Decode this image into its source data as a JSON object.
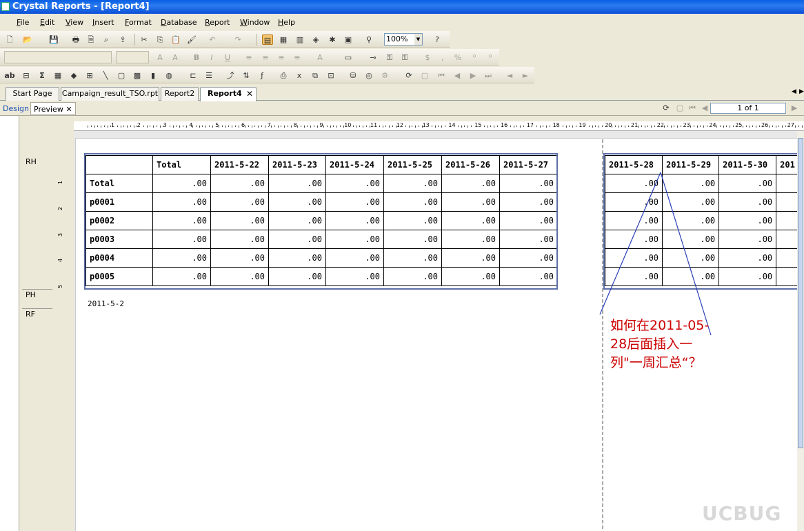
{
  "window": {
    "title": "Crystal Reports - [Report4]"
  },
  "menu": [
    "File",
    "Edit",
    "View",
    "Insert",
    "Format",
    "Database",
    "Report",
    "Window",
    "Help"
  ],
  "toolbar": {
    "zoom": "100%"
  },
  "doc_tabs": [
    {
      "label": "Start Page"
    },
    {
      "label": "Campaign_result_TSO.rpt"
    },
    {
      "label": "Report2"
    },
    {
      "label": "Report4",
      "active": true
    }
  ],
  "view_tabs": {
    "design": "Design",
    "preview": "Preview"
  },
  "navigator": {
    "page": "1 of 1"
  },
  "sections": {
    "rh": "RH",
    "ph": "PH",
    "rf": "RF"
  },
  "ruler_numbers": [
    "1",
    "2",
    "3",
    "4",
    "5",
    "6",
    "7",
    "8",
    "9",
    "10",
    "11",
    "12",
    "13",
    "14",
    "15",
    "16",
    "17",
    "18",
    "19",
    "20",
    "21",
    "22",
    "23",
    "24",
    "25",
    "26",
    "27"
  ],
  "vruler_numbers": [
    "1",
    "2",
    "3",
    "4",
    "5"
  ],
  "crosstab_left": {
    "header": [
      "",
      "Total",
      "2011-5-22",
      "2011-5-23",
      "2011-5-24",
      "2011-5-25",
      "2011-5-26",
      "2011-5-27"
    ],
    "rows": [
      {
        "label": "Total",
        "values": [
          ".00",
          ".00",
          ".00",
          ".00",
          ".00",
          ".00",
          ".00"
        ]
      },
      {
        "label": "p0001",
        "values": [
          ".00",
          ".00",
          ".00",
          ".00",
          ".00",
          ".00",
          ".00"
        ]
      },
      {
        "label": "p0002",
        "values": [
          ".00",
          ".00",
          ".00",
          ".00",
          ".00",
          ".00",
          ".00"
        ]
      },
      {
        "label": "p0003",
        "values": [
          ".00",
          ".00",
          ".00",
          ".00",
          ".00",
          ".00",
          ".00"
        ]
      },
      {
        "label": "p0004",
        "values": [
          ".00",
          ".00",
          ".00",
          ".00",
          ".00",
          ".00",
          ".00"
        ]
      },
      {
        "label": "p0005",
        "values": [
          ".00",
          ".00",
          ".00",
          ".00",
          ".00",
          ".00",
          ".00"
        ]
      }
    ]
  },
  "crosstab_right": {
    "header": [
      "2011-5-28",
      "2011-5-29",
      "2011-5-30",
      "201"
    ],
    "rows": [
      [
        ".00",
        ".00",
        ".00",
        ""
      ],
      [
        ".00",
        ".00",
        ".00",
        ""
      ],
      [
        ".00",
        ".00",
        ".00",
        ""
      ],
      [
        ".00",
        ".00",
        ".00",
        ""
      ],
      [
        ".00",
        ".00",
        ".00",
        ""
      ],
      [
        ".00",
        ".00",
        ".00",
        ""
      ]
    ]
  },
  "report_footer_text": "2011-5-2",
  "annotation": "如何在2011-05-28后面插入一列\"一周汇总“？",
  "watermark": "UCBUG",
  "colors": {
    "title_bar": "#0a5fe3",
    "annotation": "#cc0000",
    "crosstab_frame": "#5b6ea8"
  }
}
